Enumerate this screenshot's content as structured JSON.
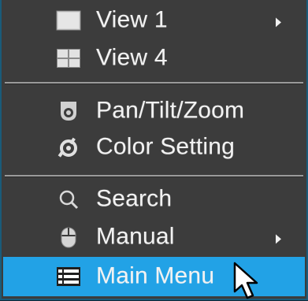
{
  "menu": {
    "items": [
      {
        "label": "View 1",
        "icon": "single-view-icon",
        "has_submenu": true
      },
      {
        "label": "View 4",
        "icon": "quad-view-icon",
        "has_submenu": false
      },
      {
        "label": "Pan/Tilt/Zoom",
        "icon": "ptz-camera-icon",
        "has_submenu": false
      },
      {
        "label": "Color Setting",
        "icon": "color-setting-icon",
        "has_submenu": false
      },
      {
        "label": "Search",
        "icon": "search-icon",
        "has_submenu": false
      },
      {
        "label": "Manual",
        "icon": "mouse-icon",
        "has_submenu": true
      },
      {
        "label": "Main Menu",
        "icon": "list-menu-icon",
        "has_submenu": false,
        "selected": true
      }
    ]
  },
  "colors": {
    "menu_background": "#3c3c3c",
    "selected_background": "#22a2e6",
    "border": "#1a5b7a",
    "text": "#f2f2f2",
    "divider": "#9a9a9a"
  }
}
